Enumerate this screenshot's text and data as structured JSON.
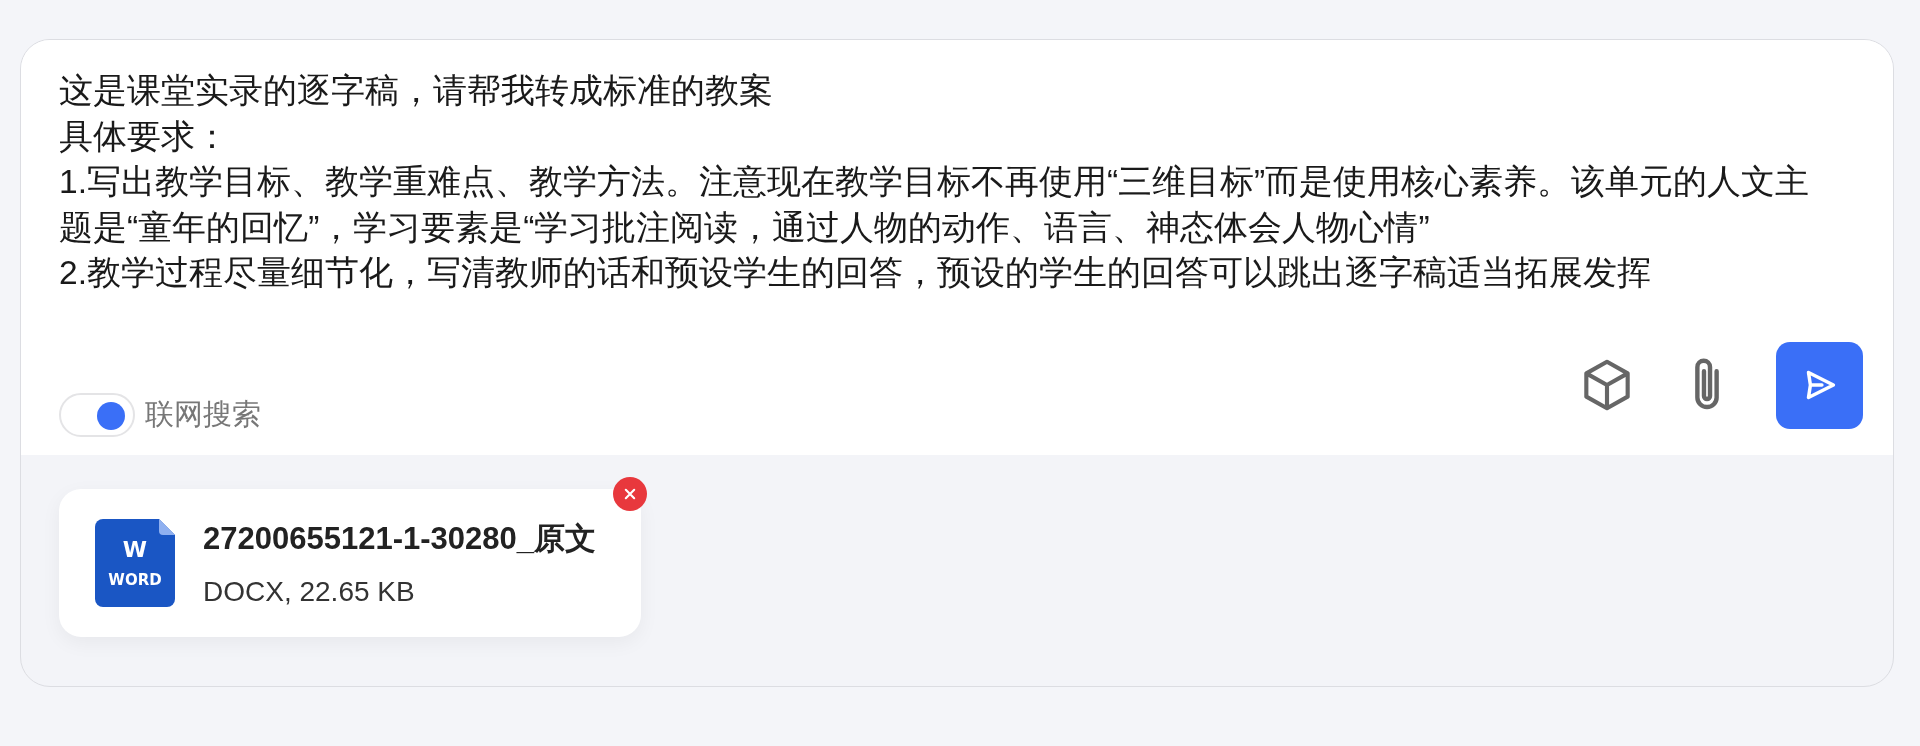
{
  "prompt": {
    "lines": [
      "这是课堂实录的逐字稿，请帮我转成标准的教案",
      "具体要求：",
      "1.写出教学目标、教学重难点、教学方法。注意现在教学目标不再使用“三维目标”而是使用核心素养。该单元的人文主",
      "题是“童年的回忆”，学习要素是“学习批注阅读，通过人物的动作、语言、神态体会人物心情”",
      "2.教学过程尽量细节化，写清教师的话和预设学生的回答，预设的学生的回答可以跳出逐字稿适当拓展发挥"
    ]
  },
  "web_search": {
    "label": "联网搜索",
    "on": true
  },
  "attachments": [
    {
      "kind": "word",
      "icon_letter": "W",
      "icon_label": "WORD",
      "name": "27200655121-1-30280_原文",
      "details": "DOCX, 22.65 KB"
    }
  ]
}
